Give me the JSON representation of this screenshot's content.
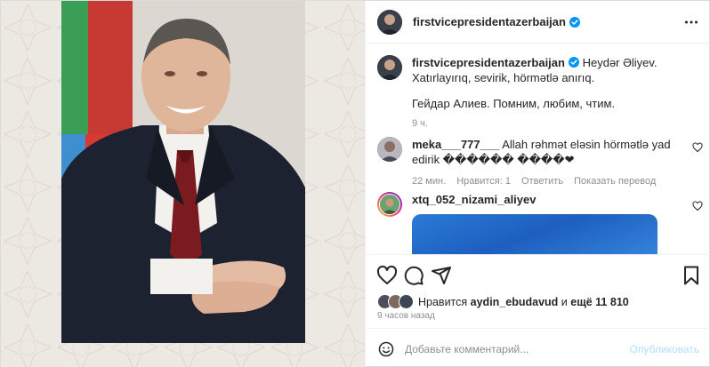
{
  "post": {
    "username": "firstvicepresidentazerbaijan",
    "verified": true,
    "caption": "Heydər Əliyev. Xatırlayırıq, sevirik, hörmətlə anırıq.",
    "caption_ru": "Гейдар Алиев. Помним, любим, чтим.",
    "caption_time": "9 ч."
  },
  "comments": [
    {
      "username": "meka___777___",
      "text": "Allah rəhmət eləsin hörmətlə yad edirik ������ ����❤",
      "time": "22 мин.",
      "likes": "Нравится: 1",
      "reply": "Ответить",
      "translate": "Показать перевод"
    },
    {
      "username": "xtq_052_nizami_aliyev",
      "text": ""
    }
  ],
  "likes_line": {
    "prefix": "Нравится",
    "user": "aydin_ebudavud",
    "middle": "и",
    "count": "ещё 11 810"
  },
  "post_time": "9 часов назад",
  "comment_box": {
    "placeholder": "Добавьте комментарий...",
    "publish": "Опубликовать"
  },
  "icons": {
    "more": "more-horizontal-icon",
    "verified": "verified-badge-icon",
    "like": "heart-icon",
    "comment": "comment-icon",
    "share": "send-icon",
    "save": "bookmark-icon",
    "emoji": "emoji-icon"
  },
  "colors": {
    "verified_blue": "#0095f6",
    "muted": "#8e8e8e",
    "publish_disabled": "#b2dffc",
    "flag_blue": "#3e8fcf",
    "flag_red": "#d63a33",
    "flag_green": "#2f9b4c"
  }
}
